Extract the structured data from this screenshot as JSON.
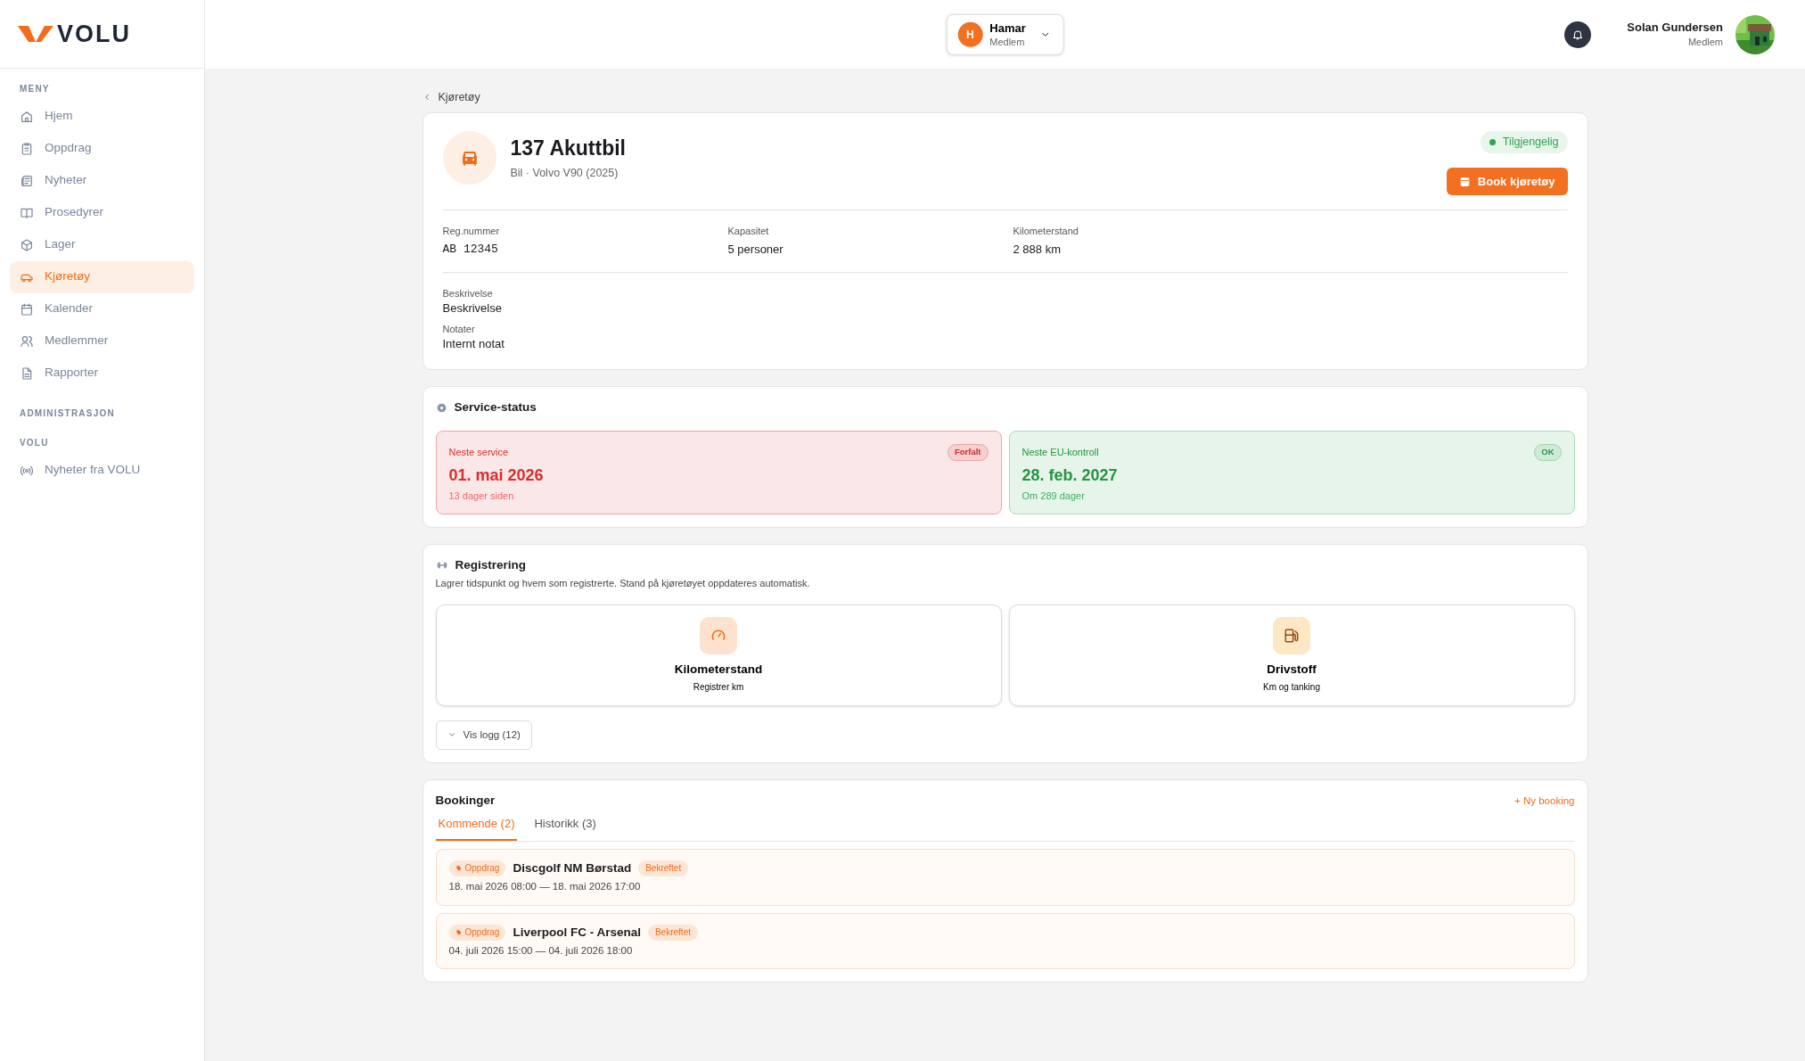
{
  "brand": {
    "name": "VOLU"
  },
  "sidebar": {
    "sections": [
      {
        "title": "MENY",
        "items": [
          {
            "label": "Hjem",
            "selected": false
          },
          {
            "label": "Oppdrag",
            "selected": false
          },
          {
            "label": "Nyheter",
            "selected": false
          },
          {
            "label": "Prosedyrer",
            "selected": false
          },
          {
            "label": "Lager",
            "selected": false
          },
          {
            "label": "Kjøretøy",
            "selected": true
          },
          {
            "label": "Kalender",
            "selected": false
          },
          {
            "label": "Medlemmer",
            "selected": false
          },
          {
            "label": "Rapporter",
            "selected": false
          }
        ]
      },
      {
        "title": "ADMINISTRASJON"
      },
      {
        "title": "VOLU",
        "items": [
          {
            "label": "Nyheter fra VOLU",
            "selected": false
          }
        ]
      }
    ]
  },
  "header": {
    "organization": {
      "initial": "H",
      "name": "Hamar",
      "role": "Medlem"
    },
    "user": {
      "name": "Solan Gundersen",
      "role": "Medlem"
    }
  },
  "breadcrumb": "Kjøretøy",
  "vehicle": {
    "title": "137 Akuttbil",
    "subtitle": "Bil · Volvo V90 (2025)",
    "status": "Tilgjengelig",
    "book_button": "Book kjøretøy",
    "fields": [
      {
        "label": "Reg.nummer",
        "value": "AB 12345",
        "kind": "mono"
      },
      {
        "label": "Kapasitet",
        "value": "5 personer",
        "kind": "text"
      },
      {
        "label": "Kilometerstand",
        "value": "2 888 km",
        "kind": "text"
      }
    ],
    "notes": [
      {
        "label": "Beskrivelse",
        "value": "Beskrivelse"
      },
      {
        "label": "Notater",
        "value": "Internt notat"
      }
    ]
  },
  "service": {
    "title": "Service-status",
    "cards": [
      {
        "label": "Neste service",
        "date": "01. mai 2026",
        "detail": "13 dager siden",
        "badge": "Forfalt",
        "kind": "overdue"
      },
      {
        "label": "Neste EU-kontroll",
        "date": "28. feb. 2027",
        "detail": "Om 289 dager",
        "badge": "OK",
        "kind": "ok"
      }
    ]
  },
  "registration": {
    "title": "Registrering",
    "description": "Lagrer tidspunkt og hvem som registrerte. Stand på kjøretøyet oppdateres automatisk.",
    "actions": [
      {
        "title": "Kilometerstand",
        "subtitle": "Registrer km",
        "kind": "odometer"
      },
      {
        "title": "Drivstoff",
        "subtitle": "Km og tanking",
        "kind": "fuel"
      }
    ],
    "log_button": "Vis logg (12)"
  },
  "bookings": {
    "title": "Bookinger",
    "new_link": "+ Ny booking",
    "tabs": [
      {
        "label": "Kommende (2)",
        "selected": true
      },
      {
        "label": "Historikk (3)",
        "selected": false
      }
    ],
    "items": [
      {
        "tag": "Oppdrag",
        "title": "Discgolf NM Børstad",
        "status": "Bekreftet",
        "time": "18. mai 2026 08:00 — 18. mai 2026 17:00"
      },
      {
        "tag": "Oppdrag",
        "title": "Liverpool FC - Arsenal",
        "status": "Bekreftet",
        "time": "04. juli 2026 15:00 — 04. juli 2026 18:00"
      }
    ]
  }
}
